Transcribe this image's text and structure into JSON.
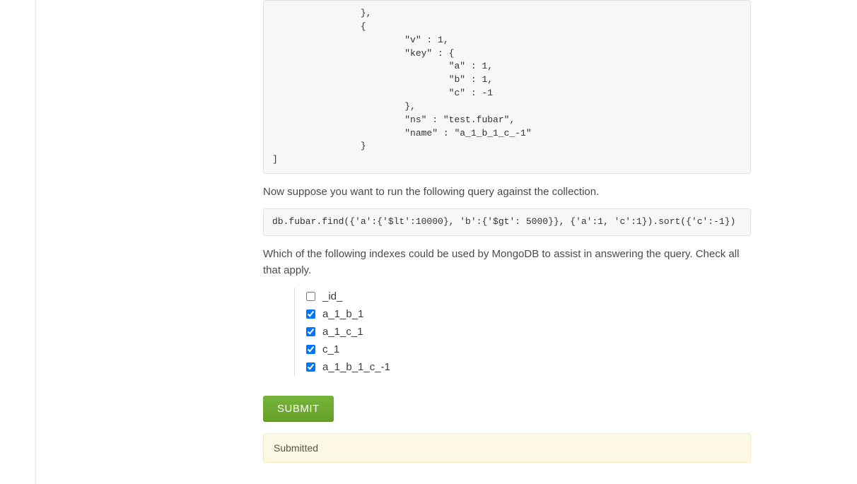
{
  "code_block_1": "                },\n                {\n                        \"v\" : 1,\n                        \"key\" : {\n                                \"a\" : 1,\n                                \"b\" : 1,\n                                \"c\" : -1\n                        },\n                        \"ns\" : \"test.fubar\",\n                        \"name\" : \"a_1_b_1_c_-1\"\n                }\n]",
  "prose_1": "Now suppose you want to run the following query against the collection.",
  "code_block_2": "db.fubar.find({'a':{'$lt':10000}, 'b':{'$gt': 5000}}, {'a':1, 'c':1}).sort({'c':-1})",
  "prose_2": "Which of the following indexes could be used by MongoDB to assist in answering the query. Check all that apply.",
  "options": [
    {
      "label": "_id_",
      "checked": false
    },
    {
      "label": "a_1_b_1",
      "checked": true
    },
    {
      "label": "a_1_c_1",
      "checked": true
    },
    {
      "label": "c_1",
      "checked": true
    },
    {
      "label": "a_1_b_1_c_-1",
      "checked": true
    }
  ],
  "buttons": {
    "submit": "Submit"
  },
  "status": "Submitted"
}
